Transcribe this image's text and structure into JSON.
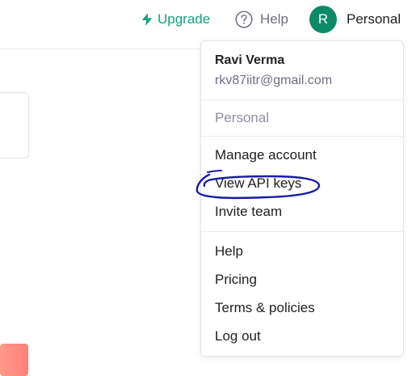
{
  "header": {
    "upgrade_label": "Upgrade",
    "help_label": "Help",
    "avatar_initial": "R",
    "account_label": "Personal"
  },
  "account_menu": {
    "user_name": "Ravi Verma",
    "user_email": "rkv87iitr@gmail.com",
    "workspace_label": "Personal",
    "items": [
      {
        "label": "Manage account"
      },
      {
        "label": "View API keys"
      },
      {
        "label": "Invite team"
      },
      {
        "label": "Help"
      },
      {
        "label": "Pricing"
      },
      {
        "label": "Terms & policies"
      },
      {
        "label": "Log out"
      }
    ]
  },
  "colors": {
    "brand": "#10a37f",
    "avatar_bg": "#0c8a68",
    "annotation_ink": "#1a1aa6",
    "muted_text": "#8e8ea0"
  },
  "icons": {
    "upgrade": "lightning-icon",
    "help": "question-circle-icon"
  }
}
